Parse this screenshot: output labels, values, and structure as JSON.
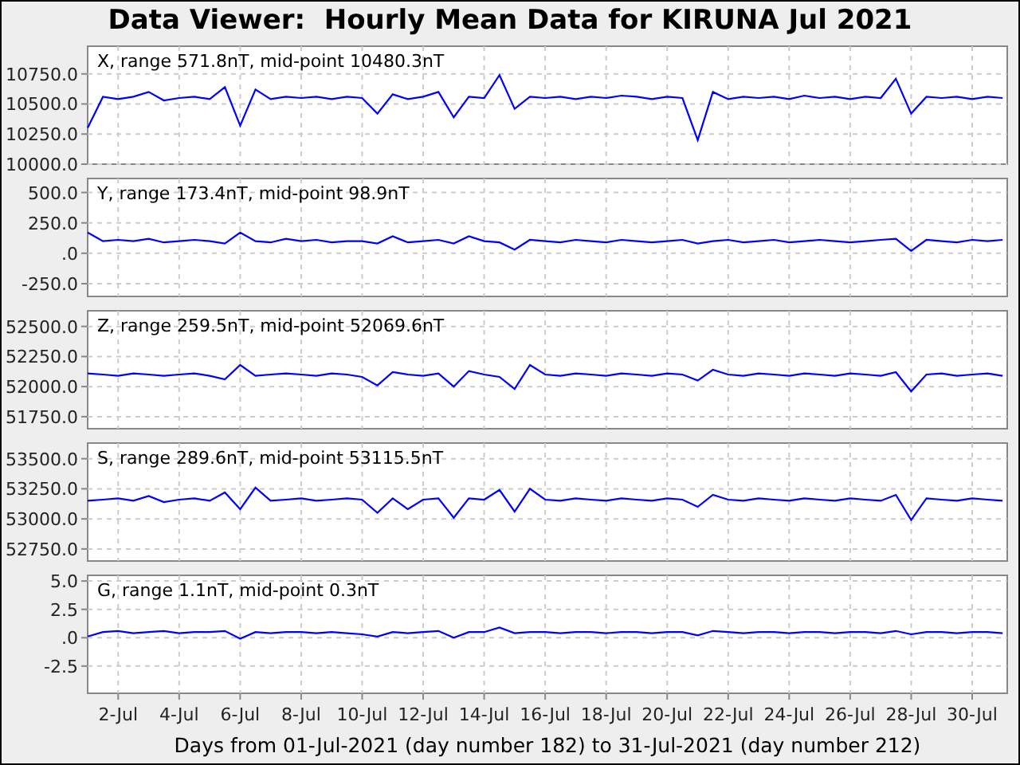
{
  "title": "Data Viewer:  Hourly Mean Data for KIRUNA Jul 2021",
  "panels": [
    {
      "chart_data": {
        "type": "line",
        "grid": true,
        "title": "X, range 571.8nT, mid-point 10480.3nT",
        "ylim": [
          10000,
          10980
        ],
        "yticks": [
          {
            "value": 10000,
            "label": "10000.0"
          },
          {
            "value": 10250,
            "label": "10250.0"
          },
          {
            "value": 10500,
            "label": "10500.0"
          },
          {
            "value": 10750,
            "label": "10750.0"
          }
        ],
        "categories": [
          null,
          null,
          null,
          null,
          null,
          null,
          null,
          null,
          null,
          null,
          null,
          null,
          null,
          null,
          null,
          null,
          null,
          null,
          null,
          null,
          null,
          null,
          null,
          null,
          null,
          null,
          null,
          null,
          null,
          null,
          null,
          null,
          null,
          null,
          null,
          null,
          null,
          null,
          null,
          null,
          null,
          null,
          null,
          null,
          null,
          null,
          null,
          null,
          null,
          null,
          null,
          null,
          null,
          null,
          null,
          null,
          null,
          null,
          null,
          null,
          null
        ],
        "series": [
          {
            "color": "#0000ff",
            "values": [
              10300,
              10560,
              10540,
              10560,
              10600,
              10530,
              10550,
              10560,
              10540,
              10640,
              10320,
              10620,
              10540,
              10560,
              10550,
              10560,
              10540,
              10560,
              10550,
              10420,
              10580,
              10540,
              10560,
              10600,
              10390,
              10560,
              10550,
              10740,
              10460,
              10560,
              10550,
              10560,
              10540,
              10560,
              10550,
              10570,
              10560,
              10540,
              10560,
              10550,
              10200,
              10600,
              10540,
              10560,
              10550,
              10560,
              10540,
              10570,
              10550,
              10560,
              10540,
              10560,
              10550,
              10710,
              10420,
              10560,
              10550,
              10560,
              10540,
              10560,
              10550
            ]
          }
        ]
      }
    },
    {
      "chart_data": {
        "type": "line",
        "grid": true,
        "title": "Y, range 173.4nT, mid-point 98.9nT",
        "ylim": [
          -355,
          615
        ],
        "yticks": [
          {
            "value": -250,
            "label": "-250.0"
          },
          {
            "value": 0,
            "label": ".0"
          },
          {
            "value": 250,
            "label": "250.0"
          },
          {
            "value": 500,
            "label": "500.0"
          }
        ],
        "categories": [
          null,
          null,
          null,
          null,
          null,
          null,
          null,
          null,
          null,
          null,
          null,
          null,
          null,
          null,
          null,
          null,
          null,
          null,
          null,
          null,
          null,
          null,
          null,
          null,
          null,
          null,
          null,
          null,
          null,
          null,
          null,
          null,
          null,
          null,
          null,
          null,
          null,
          null,
          null,
          null,
          null,
          null,
          null,
          null,
          null,
          null,
          null,
          null,
          null,
          null,
          null,
          null,
          null,
          null,
          null,
          null,
          null,
          null,
          null,
          null,
          null
        ],
        "series": [
          {
            "color": "#0000ff",
            "values": [
              170,
              100,
              110,
              100,
              120,
              90,
              100,
              110,
              100,
              80,
              170,
              100,
              90,
              120,
              100,
              110,
              90,
              100,
              100,
              80,
              140,
              90,
              100,
              110,
              80,
              140,
              100,
              90,
              30,
              110,
              100,
              90,
              110,
              100,
              90,
              110,
              100,
              90,
              100,
              110,
              80,
              100,
              110,
              90,
              100,
              110,
              90,
              100,
              110,
              100,
              90,
              100,
              110,
              120,
              20,
              110,
              100,
              90,
              110,
              100,
              110
            ]
          }
        ]
      }
    },
    {
      "chart_data": {
        "type": "line",
        "grid": true,
        "title": "Z, range 259.5nT, mid-point 52069.6nT",
        "ylim": [
          51650,
          52630
        ],
        "yticks": [
          {
            "value": 51750,
            "label": "51750.0"
          },
          {
            "value": 52000,
            "label": "52000.0"
          },
          {
            "value": 52250,
            "label": "52250.0"
          },
          {
            "value": 52500,
            "label": "52500.0"
          }
        ],
        "categories": [
          null,
          null,
          null,
          null,
          null,
          null,
          null,
          null,
          null,
          null,
          null,
          null,
          null,
          null,
          null,
          null,
          null,
          null,
          null,
          null,
          null,
          null,
          null,
          null,
          null,
          null,
          null,
          null,
          null,
          null,
          null,
          null,
          null,
          null,
          null,
          null,
          null,
          null,
          null,
          null,
          null,
          null,
          null,
          null,
          null,
          null,
          null,
          null,
          null,
          null,
          null,
          null,
          null,
          null,
          null,
          null,
          null,
          null,
          null,
          null,
          null
        ],
        "series": [
          {
            "color": "#0000ff",
            "values": [
              52110,
              52100,
              52090,
              52110,
              52100,
              52090,
              52100,
              52110,
              52090,
              52060,
              52180,
              52090,
              52100,
              52110,
              52100,
              52090,
              52110,
              52100,
              52080,
              52010,
              52120,
              52100,
              52090,
              52110,
              52000,
              52130,
              52100,
              52080,
              51980,
              52180,
              52100,
              52090,
              52110,
              52100,
              52090,
              52110,
              52100,
              52090,
              52110,
              52100,
              52050,
              52140,
              52100,
              52090,
              52110,
              52100,
              52090,
              52110,
              52100,
              52090,
              52110,
              52100,
              52090,
              52120,
              51960,
              52100,
              52110,
              52090,
              52100,
              52110,
              52090
            ]
          }
        ]
      }
    },
    {
      "chart_data": {
        "type": "line",
        "grid": true,
        "title": "S, range 289.6nT, mid-point 53115.5nT",
        "ylim": [
          52650,
          53630
        ],
        "yticks": [
          {
            "value": 52750,
            "label": "52750.0"
          },
          {
            "value": 53000,
            "label": "53000.0"
          },
          {
            "value": 53250,
            "label": "53250.0"
          },
          {
            "value": 53500,
            "label": "53500.0"
          }
        ],
        "categories": [
          null,
          null,
          null,
          null,
          null,
          null,
          null,
          null,
          null,
          null,
          null,
          null,
          null,
          null,
          null,
          null,
          null,
          null,
          null,
          null,
          null,
          null,
          null,
          null,
          null,
          null,
          null,
          null,
          null,
          null,
          null,
          null,
          null,
          null,
          null,
          null,
          null,
          null,
          null,
          null,
          null,
          null,
          null,
          null,
          null,
          null,
          null,
          null,
          null,
          null,
          null,
          null,
          null,
          null,
          null,
          null,
          null,
          null,
          null,
          null,
          null
        ],
        "series": [
          {
            "color": "#0000ff",
            "values": [
              53150,
              53160,
              53170,
              53150,
              53190,
              53140,
              53160,
              53170,
              53150,
              53220,
              53080,
              53260,
              53150,
              53160,
              53170,
              53150,
              53160,
              53170,
              53160,
              53050,
              53170,
              53080,
              53160,
              53170,
              53010,
              53170,
              53160,
              53240,
              53060,
              53250,
              53160,
              53150,
              53170,
              53160,
              53150,
              53170,
              53160,
              53150,
              53170,
              53160,
              53100,
              53200,
              53160,
              53150,
              53170,
              53160,
              53150,
              53170,
              53160,
              53150,
              53170,
              53160,
              53150,
              53200,
              52990,
              53170,
              53160,
              53150,
              53170,
              53160,
              53150
            ]
          }
        ]
      }
    },
    {
      "chart_data": {
        "type": "line",
        "grid": true,
        "title": "G, range 1.1nT, mid-point 0.3nT",
        "xlabel": "Days from 01-Jul-2021 (day number 182) to 31-Jul-2021 (day number 212)",
        "ylim": [
          -4.9,
          5.5
        ],
        "yticks": [
          {
            "value": -2.5,
            "label": "-2.5"
          },
          {
            "value": 0,
            "label": ".0"
          },
          {
            "value": 2.5,
            "label": "2.5"
          },
          {
            "value": 5,
            "label": "5.0"
          }
        ],
        "categories": [
          null,
          null,
          "2-Jul",
          null,
          null,
          null,
          "4-Jul",
          null,
          null,
          null,
          "6-Jul",
          null,
          null,
          null,
          "8-Jul",
          null,
          null,
          null,
          "10-Jul",
          null,
          null,
          null,
          "12-Jul",
          null,
          null,
          null,
          "14-Jul",
          null,
          null,
          null,
          "16-Jul",
          null,
          null,
          null,
          "18-Jul",
          null,
          null,
          null,
          "20-Jul",
          null,
          null,
          null,
          "22-Jul",
          null,
          null,
          null,
          "24-Jul",
          null,
          null,
          null,
          "26-Jul",
          null,
          null,
          null,
          "28-Jul",
          null,
          null,
          null,
          "30-Jul",
          null,
          null
        ],
        "series": [
          {
            "color": "#0000ff",
            "values": [
              0.1,
              0.5,
              0.6,
              0.4,
              0.5,
              0.6,
              0.4,
              0.5,
              0.5,
              0.6,
              -0.1,
              0.5,
              0.4,
              0.5,
              0.5,
              0.4,
              0.5,
              0.4,
              0.3,
              0.1,
              0.5,
              0.4,
              0.5,
              0.6,
              0.0,
              0.5,
              0.5,
              0.9,
              0.4,
              0.5,
              0.5,
              0.4,
              0.5,
              0.5,
              0.4,
              0.5,
              0.5,
              0.4,
              0.5,
              0.5,
              0.2,
              0.6,
              0.5,
              0.4,
              0.5,
              0.5,
              0.4,
              0.5,
              0.5,
              0.4,
              0.5,
              0.5,
              0.4,
              0.6,
              0.3,
              0.5,
              0.5,
              0.4,
              0.5,
              0.5,
              0.4
            ]
          }
        ]
      }
    }
  ]
}
